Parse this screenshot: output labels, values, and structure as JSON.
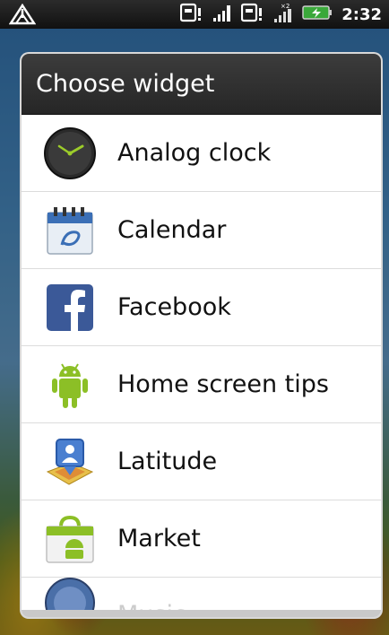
{
  "status_bar": {
    "time": "2:32",
    "icons": [
      "warning-icon",
      "sim-card-icon",
      "signal-icon",
      "sim-card-icon",
      "signal-roaming-icon",
      "battery-charging-icon"
    ]
  },
  "dialog": {
    "title": "Choose widget",
    "items": [
      {
        "label": "Analog clock",
        "icon": "analog-clock-icon"
      },
      {
        "label": "Calendar",
        "icon": "calendar-icon"
      },
      {
        "label": "Facebook",
        "icon": "facebook-icon"
      },
      {
        "label": "Home screen tips",
        "icon": "android-icon"
      },
      {
        "label": "Latitude",
        "icon": "latitude-icon"
      },
      {
        "label": "Market",
        "icon": "market-icon"
      },
      {
        "label": "Music",
        "icon": "music-icon"
      }
    ]
  },
  "colors": {
    "header_bg": "#2e2e2e",
    "accent_green": "#8cbf26"
  }
}
